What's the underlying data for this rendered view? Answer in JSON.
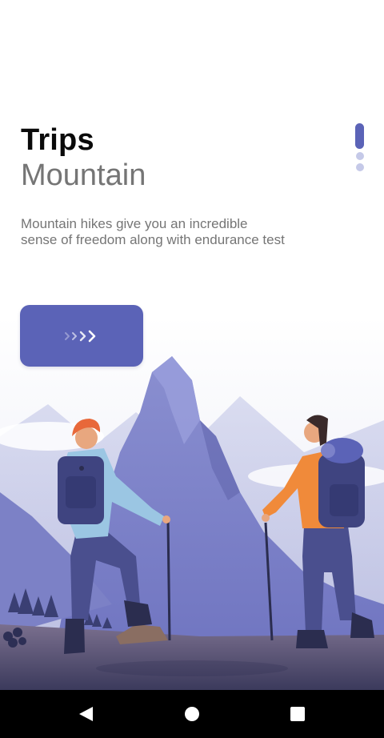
{
  "onboarding": {
    "title": "Trips",
    "subtitle": "Mountain",
    "description": "Mountain hikes give you an incredible sense of freedom along with endurance test",
    "next_button_icon": "chevrons-right-icon",
    "page_indicator": {
      "current": 1,
      "total": 3
    }
  },
  "colors": {
    "accent": "#5b63b7",
    "indicator_inactive": "#c5c9e8",
    "title": "#0a0a0a",
    "secondary_text": "#757575",
    "nav_bar": "#000000"
  },
  "illustration": {
    "name": "two-hikers-mountain-illustration"
  },
  "nav_bar": {
    "back_icon": "back-triangle-icon",
    "home_icon": "home-circle-icon",
    "recents_icon": "recents-square-icon"
  }
}
